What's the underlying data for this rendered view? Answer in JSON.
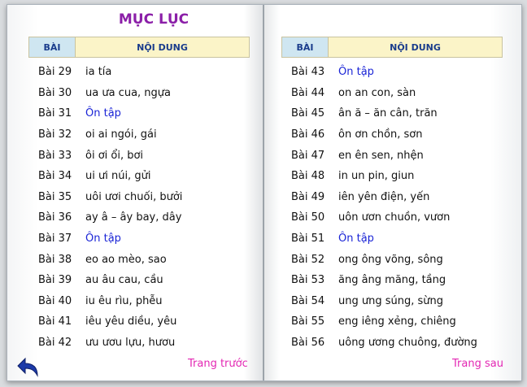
{
  "title": "MỤC LỤC",
  "header": {
    "col1": "BÀI",
    "col2": "NỘI DUNG"
  },
  "left_lessons": [
    {
      "num": "Bài 29",
      "text": "ia tía",
      "review": false
    },
    {
      "num": "Bài 30",
      "text": "ua ưa cua, ngựa",
      "review": false
    },
    {
      "num": "Bài 31",
      "text": "Ôn tập",
      "review": true
    },
    {
      "num": "Bài 32",
      "text": "oi ai ngói, gái",
      "review": false
    },
    {
      "num": "Bài 33",
      "text": "ôi ơi ổi, bơi",
      "review": false
    },
    {
      "num": "Bài 34",
      "text": "ui ưi núi, gửi",
      "review": false
    },
    {
      "num": "Bài 35",
      "text": "uôi ươi chuối, bưởi",
      "review": false
    },
    {
      "num": "Bài 36",
      "text": "ay â – ây bay, dây",
      "review": false
    },
    {
      "num": "Bài 37",
      "text": "Ôn tập",
      "review": true
    },
    {
      "num": "Bài 38",
      "text": "eo ao mèo, sao",
      "review": false
    },
    {
      "num": "Bài 39",
      "text": "au âu cau, cầu",
      "review": false
    },
    {
      "num": "Bài 40",
      "text": "iu êu rìu, phễu",
      "review": false
    },
    {
      "num": "Bài 41",
      "text": "iêu yêu diều, yêu",
      "review": false
    },
    {
      "num": "Bài 42",
      "text": "ưu ươu lựu, hươu",
      "review": false
    }
  ],
  "right_lessons": [
    {
      "num": "Bài 43",
      "text": "Ôn tập",
      "review": true
    },
    {
      "num": "Bài 44",
      "text": "on an con, sàn",
      "review": false
    },
    {
      "num": "Bài 45",
      "text": "ân ă – ăn cân, trăn",
      "review": false
    },
    {
      "num": "Bài 46",
      "text": "ôn ơn chồn, sơn",
      "review": false
    },
    {
      "num": "Bài 47",
      "text": "en ên sen, nhện",
      "review": false
    },
    {
      "num": "Bài 48",
      "text": "in un pin, giun",
      "review": false
    },
    {
      "num": "Bài 49",
      "text": "iên yên điện, yến",
      "review": false
    },
    {
      "num": "Bài 50",
      "text": "uôn ươn chuồn, vươn",
      "review": false
    },
    {
      "num": "Bài 51",
      "text": "Ôn tập",
      "review": true
    },
    {
      "num": "Bài 52",
      "text": "ong ông võng, sông",
      "review": false
    },
    {
      "num": "Bài 53",
      "text": "ăng âng măng, tầng",
      "review": false
    },
    {
      "num": "Bài 54",
      "text": "ung ưng súng, sừng",
      "review": false
    },
    {
      "num": "Bài 55",
      "text": "eng iêng xẻng, chiêng",
      "review": false
    },
    {
      "num": "Bài 56",
      "text": "uông ương chuông, đường",
      "review": false
    }
  ],
  "nav": {
    "prev": "Trang trước",
    "next": "Trang sau"
  },
  "icons": {
    "back": "back-arrow-icon"
  },
  "colors": {
    "title": "#8b1fa8",
    "review": "#1a24d6",
    "nav": "#e327b3",
    "header_bg": "#fbf4c8",
    "header_bai_bg": "#cfe6f1"
  }
}
